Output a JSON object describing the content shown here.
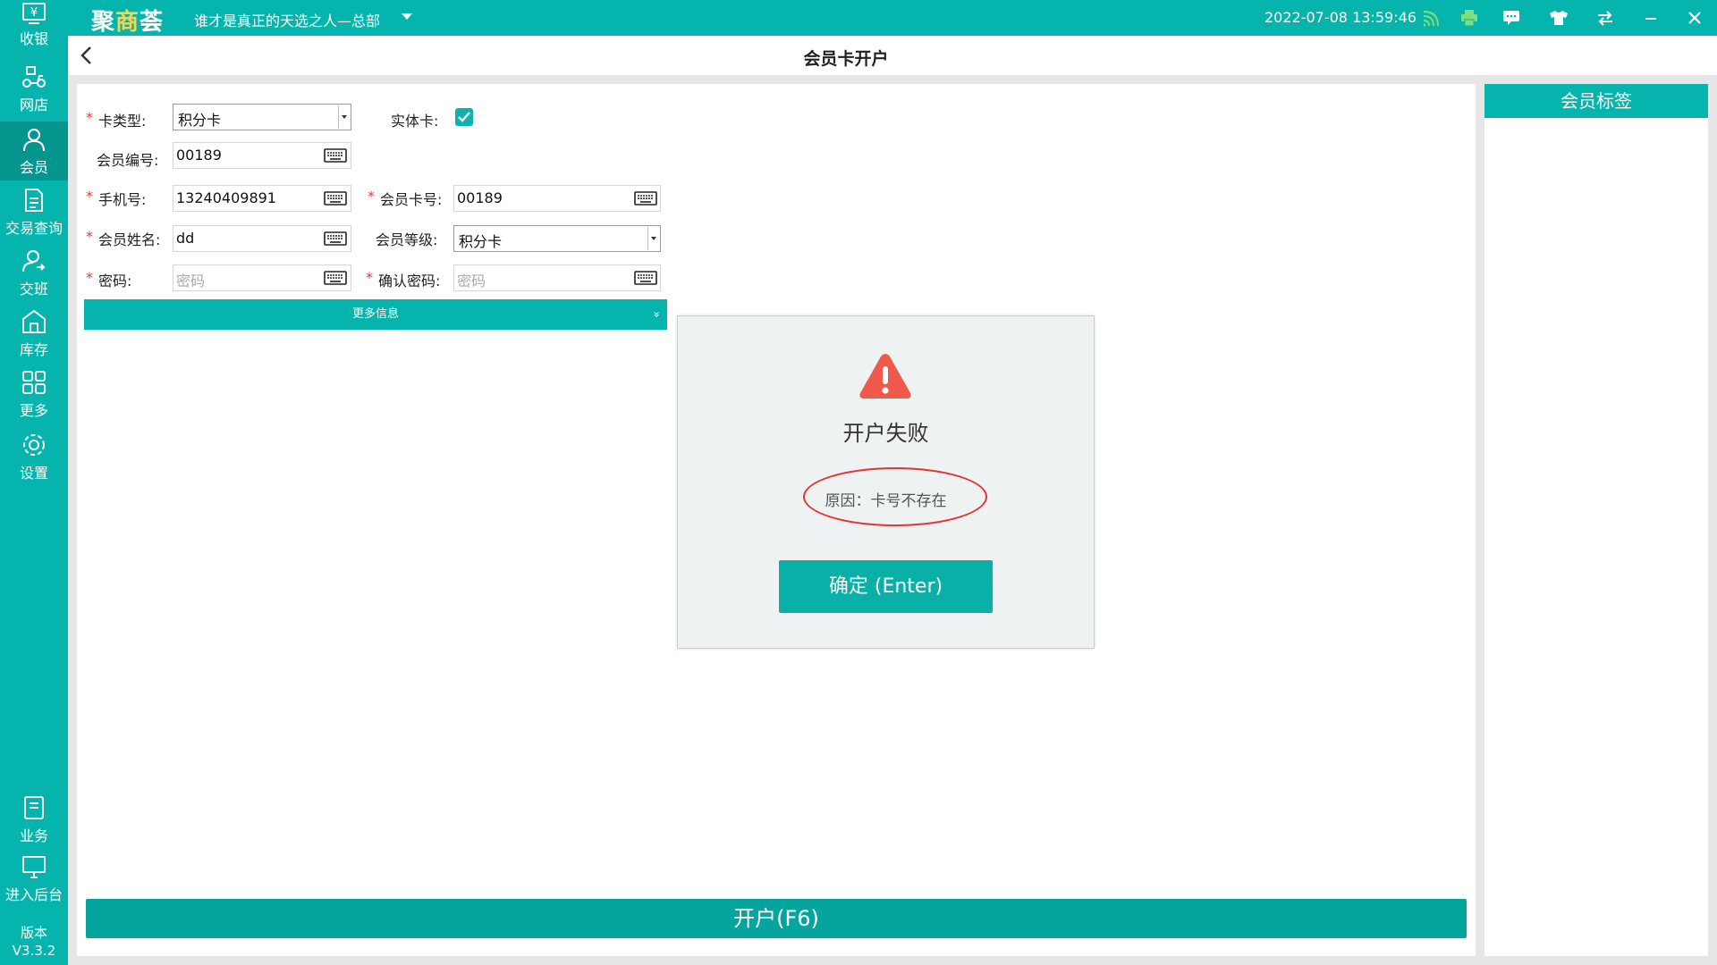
{
  "topbar": {
    "logo_part1": "聚",
    "logo_part2": "商",
    "logo_part3": "荟",
    "store_name": "谁才是真正的天选之人—总部",
    "datetime": "2022-07-08 13:59:46",
    "icons": [
      "wifi-icon",
      "printer-icon",
      "message-icon",
      "shirt-icon",
      "swap-icon",
      "minimize-icon",
      "close-icon"
    ]
  },
  "sidebar": {
    "items": [
      {
        "label": "收银",
        "icon": "yen-register-icon"
      },
      {
        "label": "网店",
        "icon": "delivery-bike-icon"
      },
      {
        "label": "会员",
        "icon": "user-icon"
      },
      {
        "label": "交易查询",
        "icon": "document-icon"
      },
      {
        "label": "交班",
        "icon": "shift-change-icon"
      },
      {
        "label": "库存",
        "icon": "warehouse-icon"
      },
      {
        "label": "更多",
        "icon": "grid-icon"
      },
      {
        "label": "设置",
        "icon": "gear-icon"
      }
    ],
    "bottom_items": [
      {
        "label": "业务",
        "icon": "book-icon"
      },
      {
        "label": "进入后台",
        "icon": "monitor-icon"
      }
    ],
    "version_label": "版本",
    "version_value": "V3.3.2"
  },
  "header": {
    "title": "会员卡开户"
  },
  "form": {
    "card_type_label": "卡类型:",
    "card_type_value": "积分卡",
    "physical_card_label": "实体卡:",
    "physical_card_checked": true,
    "member_no_label": "会员编号:",
    "member_no_value": "00189",
    "phone_label": "手机号:",
    "phone_value": "13240409891",
    "card_no_label": "会员卡号:",
    "card_no_value": "00189",
    "name_label": "会员姓名:",
    "name_value": "dd",
    "level_label": "会员等级:",
    "level_value": "积分卡",
    "password_label": "密码:",
    "password_placeholder": "密码",
    "confirm_password_label": "确认密码:",
    "confirm_password_placeholder": "密码",
    "required_mark": "*",
    "more_info": "更多信息",
    "more_caret": "»",
    "submit": "开户(F6)"
  },
  "tags_panel": {
    "title": "会员标签"
  },
  "dialog": {
    "title": "开户失败",
    "reason": "原因：卡号不存在",
    "ok": "确定 (Enter)"
  },
  "colors": {
    "brand": "#05b5ad",
    "active_nav": "#04958e",
    "warning": "#ef5a4c",
    "highlight_ellipse": "#e53232"
  }
}
